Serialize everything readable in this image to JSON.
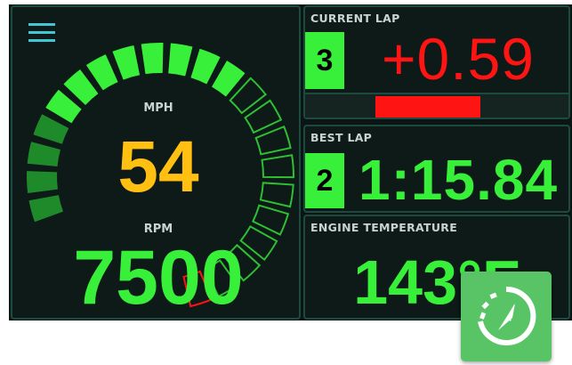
{
  "speed": {
    "label": "MPH",
    "value": "54"
  },
  "rpm": {
    "label": "RPM",
    "value": "7500",
    "gauge_level": 0.55
  },
  "current_lap": {
    "header": "CURRENT LAP",
    "lap_number": "3",
    "delta": "+0.59",
    "delta_bar_fraction": 0.4
  },
  "best_lap": {
    "header": "BEST LAP",
    "lap_number": "2",
    "time": "1:15.84"
  },
  "engine_temp": {
    "header": "ENGINE TEMPERATURE",
    "value": "143°F"
  },
  "colors": {
    "accent_green": "#38f03a",
    "dark_green": "#1f8a2a",
    "speed_yellow": "#ffc012",
    "delta_red": "#ff1414",
    "menu_cyan": "#3fc7d6",
    "fab_green": "#59c465"
  },
  "icons": {
    "menu": "hamburger-menu-icon",
    "fab": "compass-timer-icon"
  }
}
